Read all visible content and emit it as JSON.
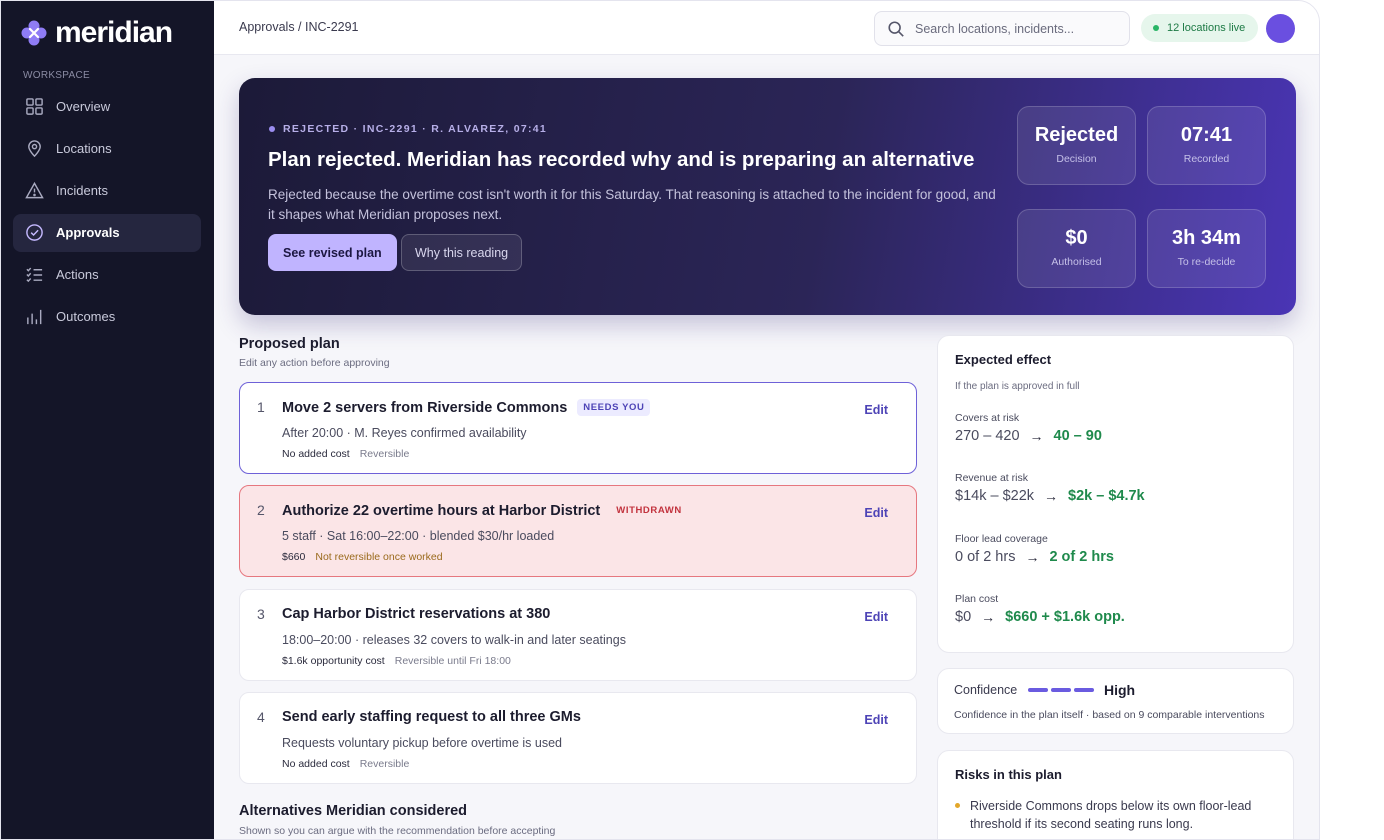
{
  "app": {
    "name": "meridian"
  },
  "sidebar": {
    "section": "WORKSPACE",
    "items": [
      {
        "label": "Overview",
        "icon": "grid-icon"
      },
      {
        "label": "Locations",
        "icon": "map-pin-icon"
      },
      {
        "label": "Incidents",
        "icon": "warning-icon"
      },
      {
        "label": "Approvals",
        "icon": "check-circle-icon",
        "active": true
      },
      {
        "label": "Actions",
        "icon": "checklist-icon"
      },
      {
        "label": "Outcomes",
        "icon": "bar-chart-icon"
      }
    ]
  },
  "topbar": {
    "breadcrumb": "Approvals / INC-2291",
    "search_placeholder": "Search locations, incidents...",
    "live_status": "12 locations live"
  },
  "hero": {
    "tag": "REJECTED · INC-2291 · R. ALVAREZ, 07:41",
    "title": "Plan rejected. Meridian has recorded why and is preparing an alternative",
    "body": "Rejected because the overtime cost isn't worth it for this Saturday. That reasoning is attached to the incident for good, and it shapes what Meridian proposes next.",
    "primary_button": "See revised plan",
    "secondary_button": "Why this reading",
    "stats": [
      {
        "value": "Rejected",
        "label": "Decision"
      },
      {
        "value": "07:41",
        "label": "Recorded"
      },
      {
        "value": "$0",
        "label": "Authorised"
      },
      {
        "value": "3h 34m",
        "label": "To re-decide"
      }
    ]
  },
  "plan": {
    "title": "Proposed plan",
    "subtitle": "Edit any action before approving",
    "edit_label": "Edit",
    "items": [
      {
        "num": "1",
        "title": "Move 2 servers from Riverside Commons",
        "badge": "NEEDS YOU",
        "detail": "After 20:00 · M. Reyes confirmed availability",
        "cost": "No added cost",
        "reversibility": "Reversible"
      },
      {
        "num": "2",
        "title": "Authorize 22 overtime hours at Harbor District",
        "badge": "WITHDRAWN",
        "detail": "5 staff · Sat 16:00–22:00 · blended $30/hr loaded",
        "cost": "$660",
        "reversibility": "Not reversible once worked"
      },
      {
        "num": "3",
        "title": "Cap Harbor District reservations at 380",
        "badge": "",
        "detail": "18:00–20:00 · releases 32 covers to walk-in and later seatings",
        "cost": "$1.6k opportunity cost",
        "reversibility": "Reversible until Fri 18:00"
      },
      {
        "num": "4",
        "title": "Send early staffing request to all three GMs",
        "badge": "",
        "detail": "Requests voluntary pickup before overtime is used",
        "cost": "No added cost",
        "reversibility": "Reversible"
      }
    ]
  },
  "alternatives": {
    "title": "Alternatives Meridian considered",
    "subtitle": "Shown so you can argue with the recommendation before accepting"
  },
  "effect": {
    "title": "Expected effect",
    "subtitle": "If the plan is approved in full",
    "metrics": [
      {
        "label": "Covers at risk",
        "from": "270 – 420",
        "to": "40 – 90"
      },
      {
        "label": "Revenue at risk",
        "from": "$14k – $22k",
        "to": "$2k – $4.7k"
      },
      {
        "label": "Floor lead coverage",
        "from": "0 of 2 hrs",
        "to": "2 of 2 hrs"
      },
      {
        "label": "Plan cost",
        "from": "$0",
        "to": "$660 + $1.6k opp."
      }
    ]
  },
  "confidence": {
    "label": "Confidence",
    "value": "High",
    "note": "Confidence in the plan itself · based on 9 comparable interventions"
  },
  "risks": {
    "title": "Risks in this plan",
    "items": [
      "Riverside Commons drops below its own floor-lead threshold if its second seating runs long."
    ]
  },
  "colors": {
    "accent": "#6a5be0",
    "positive": "#1f8a4c",
    "danger": "#c2323d"
  }
}
